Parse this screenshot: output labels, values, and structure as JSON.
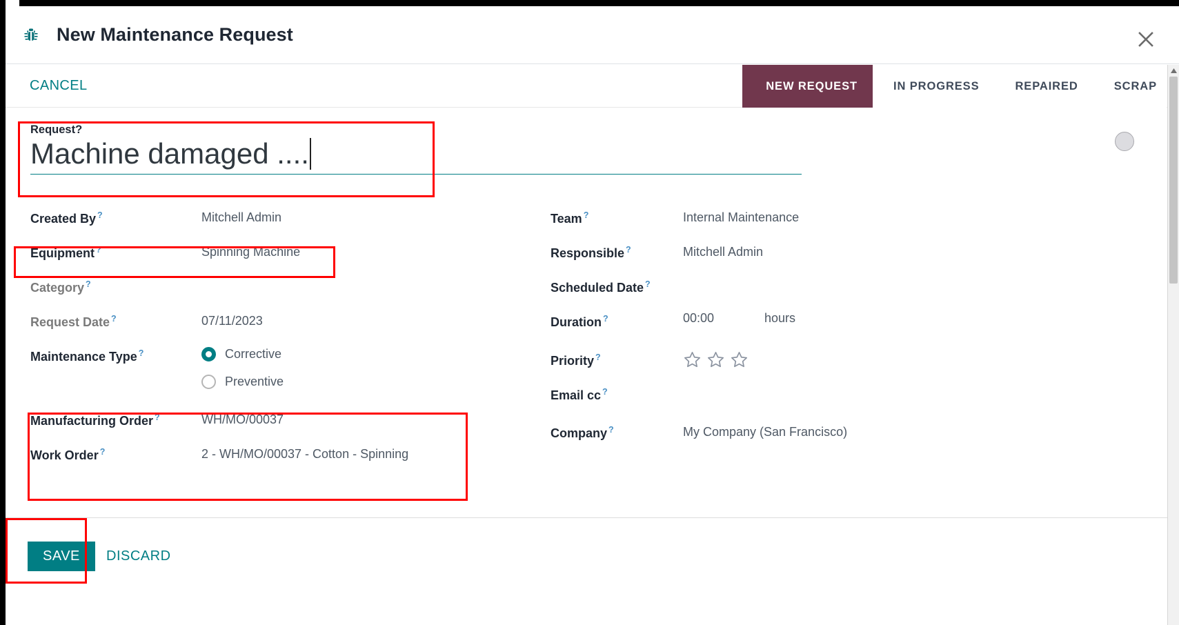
{
  "window": {
    "title": "New Maintenance Request",
    "icon": "bug-icon",
    "close_label": "✕"
  },
  "control_panel": {
    "cancel_label": "CANCEL",
    "stages": [
      {
        "label": "NEW REQUEST",
        "active": true
      },
      {
        "label": "IN PROGRESS",
        "active": false
      },
      {
        "label": "REPAIRED",
        "active": false
      },
      {
        "label": "SCRAP",
        "active": false
      }
    ]
  },
  "form": {
    "title_field": {
      "label": "Request",
      "help": "?",
      "value": "Machine damaged ....",
      "focused": true
    },
    "left_column": [
      {
        "label": "Created By",
        "help": "?",
        "value": "Mitchell Admin",
        "dim_label": false
      },
      {
        "label": "Equipment",
        "help": "?",
        "value": "Spinning Machine",
        "dim_label": false
      },
      {
        "label": "Category",
        "help": "?",
        "value": "",
        "dim_label": true
      },
      {
        "label": "Request Date",
        "help": "?",
        "value": "07/11/2023",
        "dim_label": true
      },
      {
        "label": "Maintenance Type",
        "help": "?",
        "value": "",
        "dim_label": false
      }
    ],
    "maintenance_type": {
      "label": "Maintenance Type",
      "help": "?",
      "options": [
        {
          "label": "Corrective",
          "selected": true
        },
        {
          "label": "Preventive",
          "selected": false
        }
      ]
    },
    "order_fields": [
      {
        "label": "Manufacturing Order",
        "help": "?",
        "value": "WH/MO/00037"
      },
      {
        "label": "Work Order",
        "help": "?",
        "value": "2 - WH/MO/00037 - Cotton - Spinning"
      }
    ],
    "right_column": [
      {
        "label": "Team",
        "help": "?",
        "value": "Internal Maintenance"
      },
      {
        "label": "Responsible",
        "help": "?",
        "value": "Mitchell Admin"
      },
      {
        "label": "Scheduled Date",
        "help": "?",
        "value": ""
      }
    ],
    "duration": {
      "label": "Duration",
      "help": "?",
      "value": "00:00",
      "unit": "hours"
    },
    "priority": {
      "label": "Priority",
      "help": "?",
      "stars_total": 3,
      "stars_filled": 0
    },
    "email_cc": {
      "label": "Email cc",
      "help": "?",
      "value": ""
    },
    "company": {
      "label": "Company",
      "help": "?",
      "value": "My Company (San Francisco)"
    }
  },
  "footer": {
    "save_label": "SAVE",
    "discard_label": "DISCARD"
  },
  "colors": {
    "accent_teal": "#017e84",
    "stage_active": "#71374d",
    "highlight_red": "#ff0000",
    "label_dark": "#1f2733",
    "value_gray": "#4e5864"
  }
}
